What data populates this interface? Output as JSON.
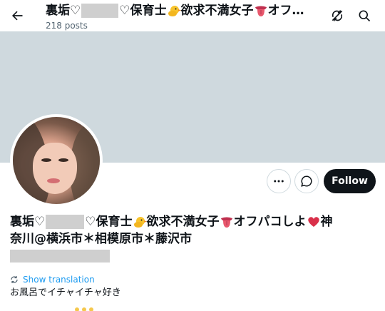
{
  "header": {
    "title_parts": [
      "裏垢♡",
      "♡保育士",
      "欲求不満女子",
      "オフ…"
    ],
    "posts_count": "218 posts",
    "icons": {
      "back": "back-arrow-icon",
      "sync": "sync-off-icon",
      "search": "search-icon"
    }
  },
  "profile": {
    "name_line1_parts": [
      "裏垢♡",
      "♡保育士",
      "欲求不満女子",
      "オフパコしよ",
      "神"
    ],
    "name_line2": "奈川@横浜市＊相模原市＊藤沢市",
    "emoji": {
      "chick": "chick-emoji",
      "tongue": "tongue-emoji",
      "heart": "heart-exclamation-emoji"
    }
  },
  "actions": {
    "more_icon": "more-icon",
    "message_icon": "message-icon",
    "follow_label": "Follow"
  },
  "translation": {
    "label": "Show translation",
    "icon": "translate-icon"
  },
  "bio": {
    "text": "お風呂でイチャイチャ好き"
  },
  "colors": {
    "banner": "#cfd9de",
    "text": "#0f1419",
    "muted": "#536471",
    "link": "#1d9bf0",
    "follow_bg": "#0f1419",
    "redaction": "#cfcfcf"
  }
}
